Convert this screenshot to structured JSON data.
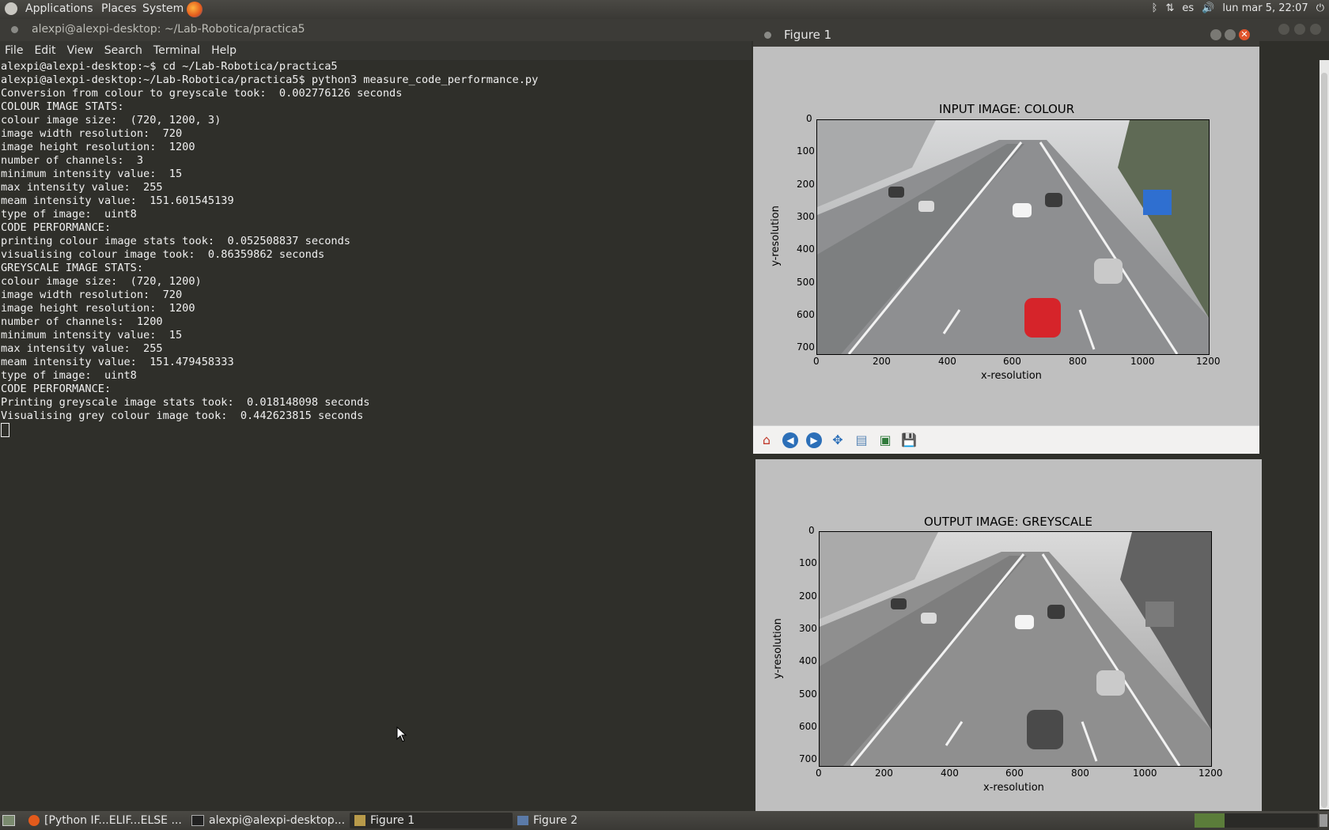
{
  "top_panel": {
    "menus": [
      "Applications",
      "Places",
      "System"
    ],
    "keyboard_layout": "es",
    "clock": "lun mar  5, 22:07"
  },
  "terminal": {
    "title": "alexpi@alexpi-desktop: ~/Lab-Robotica/practica5",
    "menu": [
      "File",
      "Edit",
      "View",
      "Search",
      "Terminal",
      "Help"
    ],
    "lines": [
      "alexpi@alexpi-desktop:~$ cd ~/Lab-Robotica/practica5",
      "alexpi@alexpi-desktop:~/Lab-Robotica/practica5$ python3 measure_code_performance.py",
      "",
      "Conversion from colour to greyscale took:  0.002776126 seconds",
      "COLOUR IMAGE STATS:",
      "colour image size:  (720, 1200, 3)",
      "image width resolution:  720",
      "image height resolution:  1200",
      "number of channels:  3",
      "minimum intensity value:  15",
      "max intensity value:  255",
      "meam intensity value:  151.601545139",
      "type of image:  uint8",
      "",
      "CODE PERFORMANCE:",
      "printing colour image stats took:  0.052508837 seconds",
      "visualising colour image took:  0.86359862 seconds",
      "GREYSCALE IMAGE STATS:",
      "colour image size:  (720, 1200)",
      "image width resolution:  720",
      "image height resolution:  1200",
      "number of channels:  1200",
      "minimum intensity value:  15",
      "max intensity value:  255",
      "meam intensity value:  151.479458333",
      "type of image:  uint8",
      "",
      "CODE PERFORMANCE:",
      "Printing greyscale image stats took:  0.018148098 seconds",
      "Visualising grey colour image took:  0.442623815 seconds"
    ]
  },
  "figure1": {
    "title": "Figure 1",
    "plot_title": "INPUT IMAGE: COLOUR",
    "xlabel": "x-resolution",
    "ylabel": "y-resolution",
    "xticks": [
      "0",
      "200",
      "400",
      "600",
      "800",
      "1000",
      "1200"
    ],
    "yticks": [
      "0",
      "100",
      "200",
      "300",
      "400",
      "500",
      "600",
      "700"
    ],
    "toolbar_icons": [
      "home-icon",
      "back-icon",
      "forward-icon",
      "pan-icon",
      "configure-subplots-icon",
      "edit-axis-icon",
      "save-icon"
    ]
  },
  "figure2": {
    "plot_title": "OUTPUT IMAGE: GREYSCALE",
    "xlabel": "x-resolution",
    "ylabel": "y-resolution",
    "xticks": [
      "0",
      "200",
      "400",
      "600",
      "800",
      "1000",
      "1200"
    ],
    "yticks": [
      "0",
      "100",
      "200",
      "300",
      "400",
      "500",
      "600",
      "700"
    ]
  },
  "taskbar": {
    "items": [
      "[Python IF...ELIF...ELSE ...",
      "alexpi@alexpi-desktop...",
      "Figure 1",
      "Figure 2"
    ]
  },
  "colors": {
    "terminal_bg": "#2f2f2a",
    "figure_bg": "#bfbfbf",
    "close_button": "#e0542c"
  }
}
